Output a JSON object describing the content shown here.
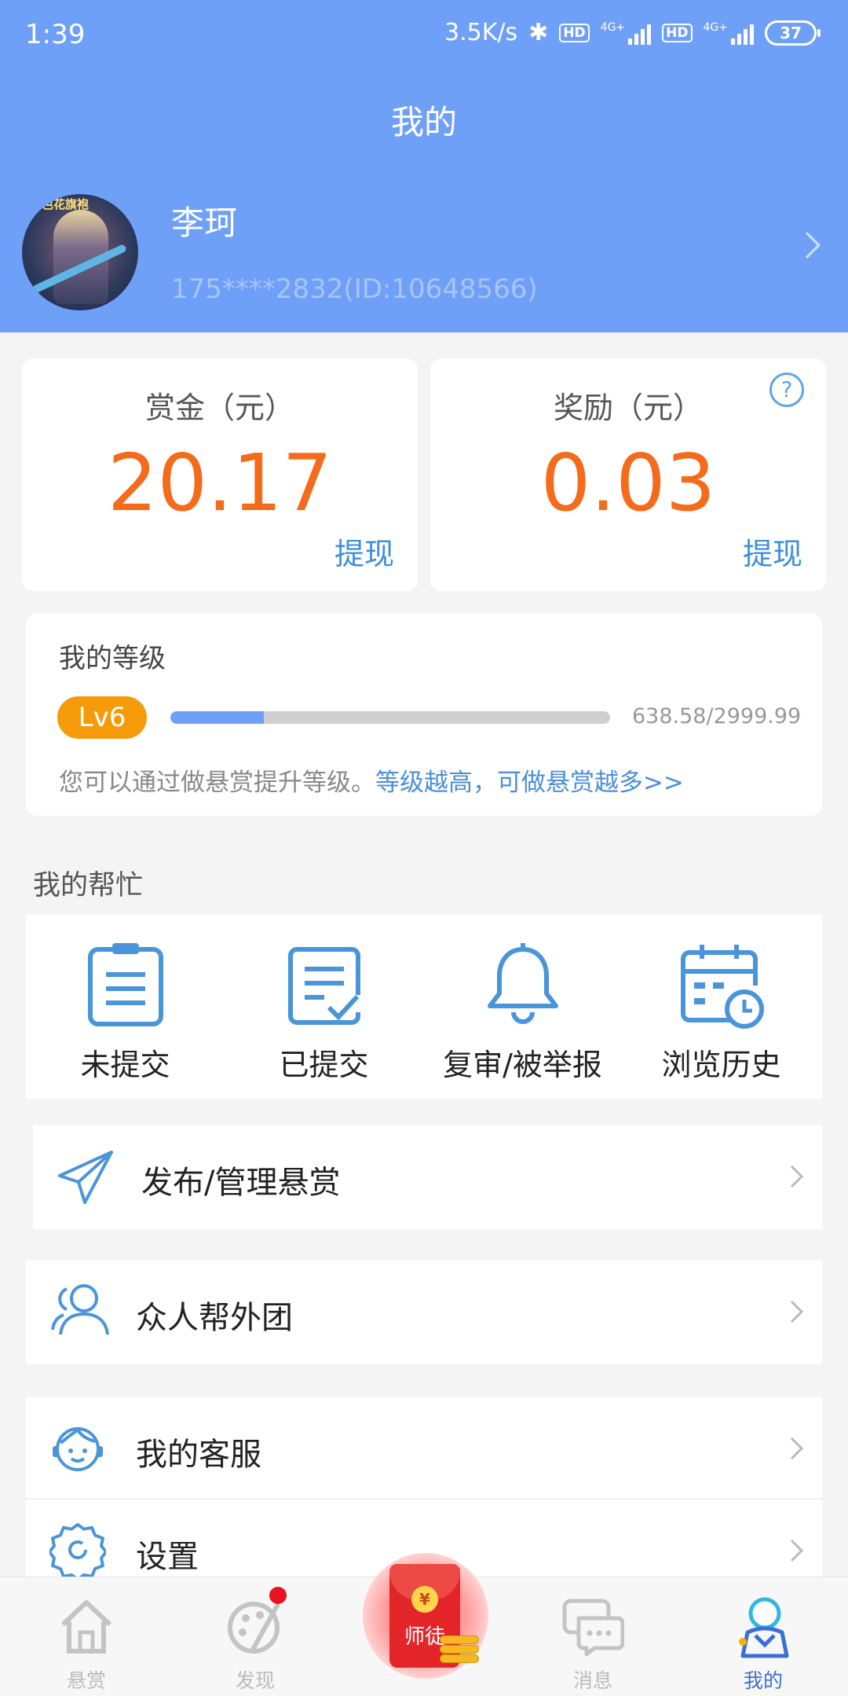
{
  "status_bar": {
    "time": "1:39",
    "speed": "3.5K/s",
    "hd1": "HD",
    "net1": "4G+",
    "hd2": "HD",
    "net2": "4G+",
    "battery": "37"
  },
  "header": {
    "title": "我的"
  },
  "profile": {
    "name": "李珂",
    "id_line": "175****2832(ID:10648566)",
    "avatar_tag": "红色花旗袍"
  },
  "wallet": {
    "bounty": {
      "label": "赏金（元）",
      "value": "20.17",
      "action": "提现"
    },
    "reward": {
      "label": "奖励（元）",
      "value": "0.03",
      "action": "提现",
      "help_icon": "?"
    }
  },
  "level": {
    "title": "我的等级",
    "badge": "Lv6",
    "progress_text": "638.58/2999.99",
    "progress_fraction": 0.213,
    "hint": "您可以通过做悬赏提升等级。",
    "hint_link": "等级越高，可做悬赏越多>>"
  },
  "help_section": {
    "title": "我的帮忙",
    "items": [
      {
        "label": "未提交",
        "icon": "clipboard-icon"
      },
      {
        "label": "已提交",
        "icon": "document-check-icon"
      },
      {
        "label": "复审/被举报",
        "icon": "bell-icon"
      },
      {
        "label": "浏览历史",
        "icon": "calendar-clock-icon"
      }
    ]
  },
  "menu": [
    {
      "label": "发布/管理悬赏",
      "icon": "paper-plane-icon"
    },
    {
      "label": "众人帮外团",
      "icon": "users-icon"
    },
    {
      "label": "我的客服",
      "icon": "customer-service-icon"
    },
    {
      "label": "设置",
      "icon": "gear-icon"
    }
  ],
  "tabbar": {
    "tabs": [
      {
        "label": "悬赏",
        "icon": "home-icon"
      },
      {
        "label": "发现",
        "icon": "palette-icon"
      },
      {
        "label": "师徒",
        "icon": "red-packet-icon"
      },
      {
        "label": "消息",
        "icon": "chat-icon"
      },
      {
        "label": "我的",
        "icon": "profile-icon"
      }
    ],
    "center_coin": "¥"
  },
  "colors": {
    "header_bg": "#6fa0f7",
    "amount": "#f36b1b",
    "link": "#3b8fdc",
    "level_badge": "#f59b0a",
    "active_tab": "#3b6fd6"
  }
}
